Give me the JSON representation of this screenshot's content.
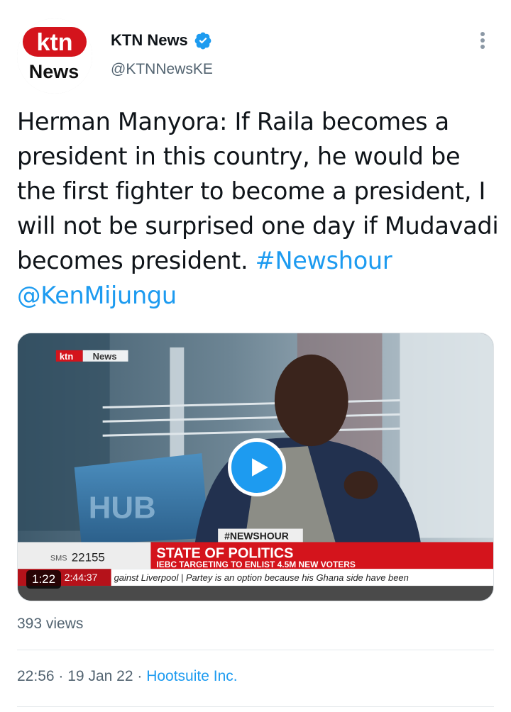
{
  "account": {
    "display_name": "KTN News",
    "handle": "@KTNNewsKE",
    "avatar_text_top": "ktn",
    "avatar_text_bottom": "News"
  },
  "tweet": {
    "text_main": "Herman Manyora: If Raila becomes a president in this country, he would be the first fighter to become a president, I will not be surprised one day if Mudavadi becomes president.",
    "hashtag": "#Newshour",
    "mention": "@KenMijungu"
  },
  "video": {
    "duration": "1:22",
    "overlay": {
      "channel_top": "ktn",
      "channel_bottom": "News",
      "tag": "#NEWSHOUR",
      "sms_label": "SMS",
      "sms_number": "22155",
      "headline": "STATE OF POLITICS",
      "subheadline": "IEBC TARGETING TO ENLIST 4.5M NEW VOTERS",
      "clock": "2:44:37",
      "ticker": "gainst Liverpool  |  Partey is an option because his Ghana side have been",
      "backdrop_text": "HUB"
    }
  },
  "stats": {
    "views": "393 views"
  },
  "meta": {
    "time": "22:56",
    "separator": "·",
    "date": "19 Jan 22",
    "source": "Hootsuite Inc."
  },
  "icons": {
    "verified": "verified-badge-icon",
    "more": "more-options-icon",
    "play": "play-icon"
  },
  "colors": {
    "accent": "#1d9bf0",
    "ktn_red": "#d4141c",
    "text_secondary": "#536471"
  }
}
